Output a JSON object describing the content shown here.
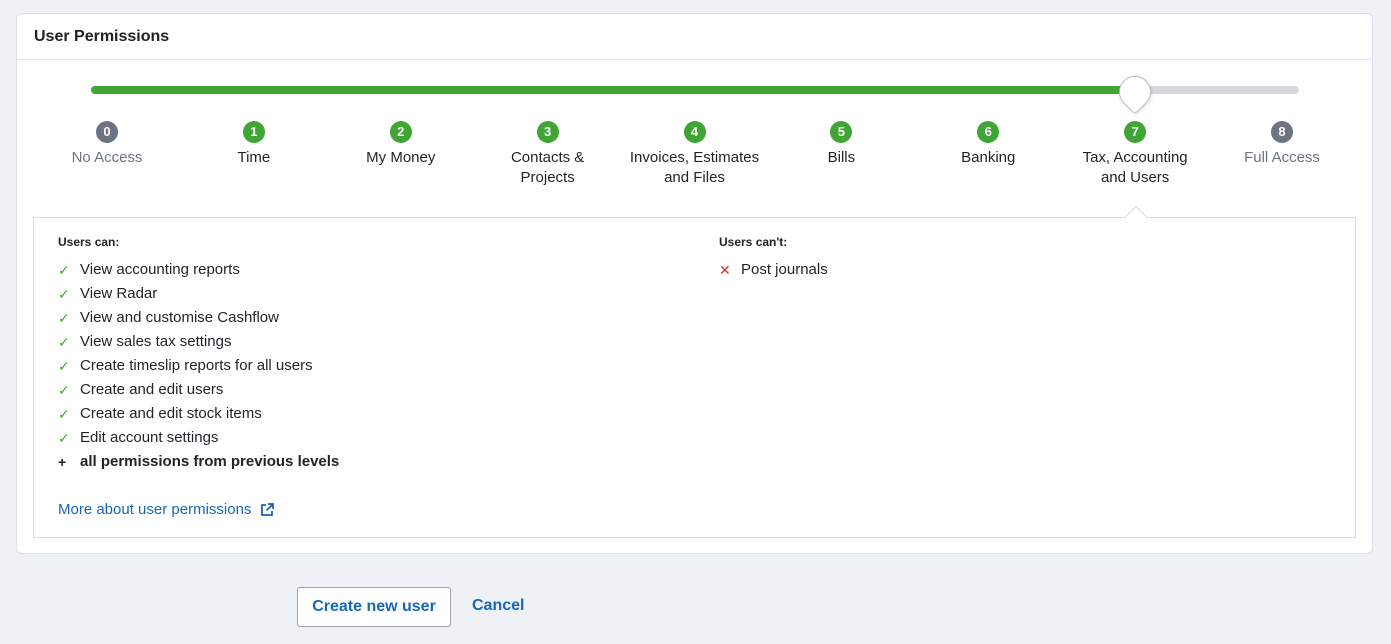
{
  "panel": {
    "title": "User Permissions"
  },
  "slider": {
    "selected_level": 7,
    "max_level": 8,
    "colors": {
      "active": "#3fa535",
      "inactive": "#6b7480"
    }
  },
  "levels": [
    {
      "num": "0",
      "label": "No Access",
      "label2": ""
    },
    {
      "num": "1",
      "label": "Time",
      "label2": ""
    },
    {
      "num": "2",
      "label": "My Money",
      "label2": ""
    },
    {
      "num": "3",
      "label": "Contacts &",
      "label2": "Projects"
    },
    {
      "num": "4",
      "label": "Invoices, Estimates",
      "label2": "and Files"
    },
    {
      "num": "5",
      "label": "Bills",
      "label2": ""
    },
    {
      "num": "6",
      "label": "Banking",
      "label2": ""
    },
    {
      "num": "7",
      "label": "Tax, Accounting",
      "label2": "and Users"
    },
    {
      "num": "8",
      "label": "Full Access",
      "label2": ""
    }
  ],
  "can": {
    "title": "Users can:",
    "items": [
      "View accounting reports",
      "View Radar",
      "View and customise Cashflow",
      "View sales tax settings",
      "Create timeslip reports for all users",
      "Create and edit users",
      "Create and edit stock items",
      "Edit account settings"
    ],
    "extra": "all permissions from previous levels"
  },
  "cant": {
    "title": "Users can't:",
    "items": [
      "Post journals"
    ]
  },
  "more_link": "More about user permissions",
  "actions": {
    "create": "Create new user",
    "cancel": "Cancel"
  }
}
